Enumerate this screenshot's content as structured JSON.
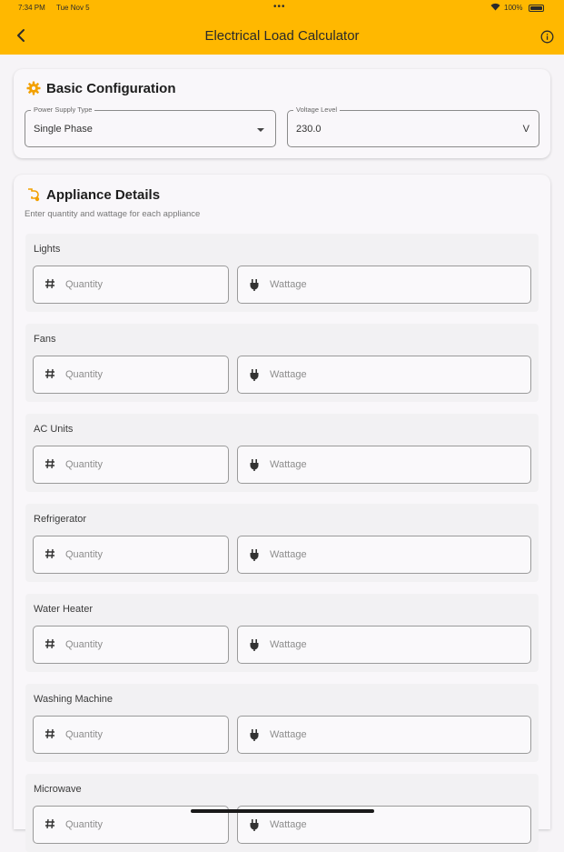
{
  "status_bar": {
    "time": "7:34 PM",
    "date": "Tue Nov 5",
    "battery": "100%"
  },
  "app_bar": {
    "title": "Electrical Load Calculator"
  },
  "basic_config": {
    "title": "Basic Configuration",
    "power_supply": {
      "label": "Power Supply Type",
      "value": "Single Phase"
    },
    "voltage": {
      "label": "Voltage Level",
      "value": "230.0",
      "unit": "V"
    }
  },
  "appliances": {
    "title": "Appliance Details",
    "subtitle": "Enter quantity and wattage for each appliance",
    "quantity_placeholder": "Quantity",
    "wattage_placeholder": "Wattage",
    "items": [
      {
        "name": "Lights"
      },
      {
        "name": "Fans"
      },
      {
        "name": "AC Units"
      },
      {
        "name": "Refrigerator"
      },
      {
        "name": "Water Heater"
      },
      {
        "name": "Washing Machine"
      },
      {
        "name": "Microwave"
      }
    ]
  },
  "colors": {
    "accent": "#ffb800",
    "icon_orange": "#f2a000"
  }
}
